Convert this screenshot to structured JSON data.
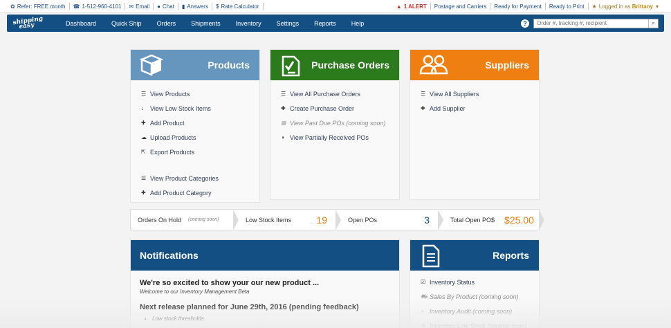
{
  "utility": {
    "refer": "Refer: FREE month",
    "phone": "1-512-960-4101",
    "email": "Email",
    "chat": "Chat",
    "answers": "Answers",
    "rate": "Rate Calculator",
    "alert": "1 ALERT",
    "postage": "Postage and Carriers",
    "ready_payment": "Ready for Payment",
    "ready_print": "Ready to Print",
    "logged_prefix": "Logged in as",
    "user": "Brittany"
  },
  "nav": {
    "logo_line1": "shipping",
    "logo_line2": "easy",
    "items": [
      "Dashboard",
      "Quick Ship",
      "Orders",
      "Shipments",
      "Inventory",
      "Settings",
      "Reports",
      "Help"
    ],
    "help_icon": "?",
    "search_placeholder": "Order #, tracking #, recipient"
  },
  "products": {
    "title": "Products",
    "items": [
      "View Products",
      "View Low Stock Items",
      "Add Product",
      "Upload Products",
      "Export Products"
    ],
    "items2": [
      "View Product Categories",
      "Add Product Category"
    ]
  },
  "purchase_orders": {
    "title": "Purchase Orders",
    "items": [
      "View All Purchase Orders",
      "Create Purchase Order",
      "View Past Due POs (coming soon)",
      "View Partially Received POs"
    ]
  },
  "suppliers": {
    "title": "Suppliers",
    "items": [
      "View All Suppliers",
      "Add Supplier"
    ]
  },
  "stats": {
    "on_hold": "Orders On Hold",
    "coming_soon": "(coming soon)",
    "low_stock": "Low Stock Items",
    "low_stock_value": "19",
    "open_pos": "Open POs",
    "open_pos_value": "3",
    "total_open": "Total Open PO$",
    "total_open_value": "$25.00"
  },
  "notifications": {
    "title": "Notifications",
    "headline": "We're so excited to show your our new product ...",
    "subline": "Welcome to our Inventory Management Beta",
    "next_release": "Next release planned for June 29th, 2016 (pending feedback)",
    "bullets": [
      "Low stock thresholds"
    ]
  },
  "reports": {
    "title": "Reports",
    "items": [
      "Inventory Status",
      "Sales By Product (coming soon)",
      "Inventory Audit (coming soon)",
      "Inventory Low Stock (coming soon)"
    ]
  },
  "colors": {
    "nav": "#144f83",
    "products": "#6695bd",
    "purchase_orders": "#2b7a1c",
    "suppliers": "#f07f12"
  }
}
